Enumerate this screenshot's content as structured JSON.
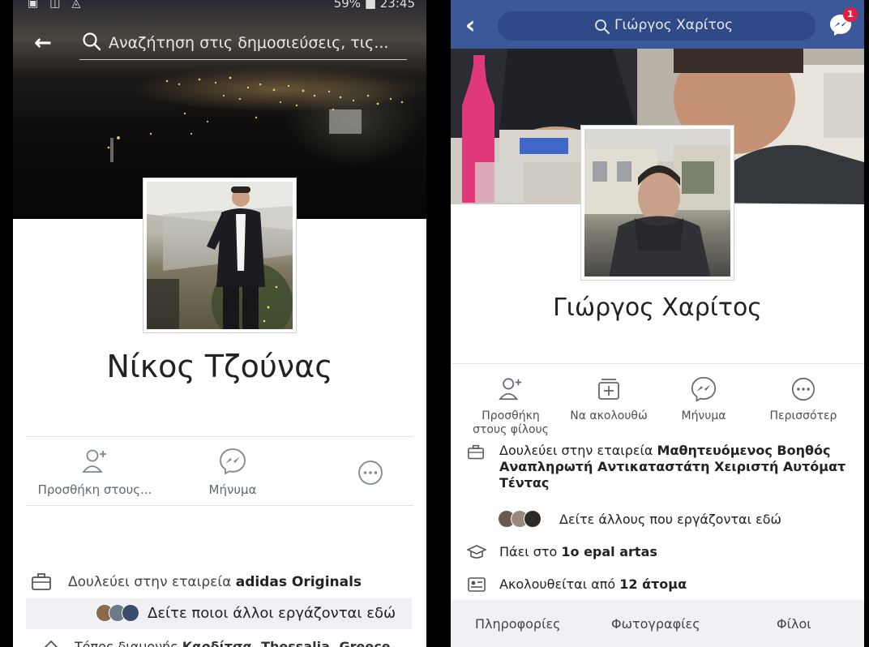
{
  "left": {
    "status_right": "59% ■ 23:45",
    "search_placeholder": "Αναζήτηση στις δημοσιεύσεις, τις...",
    "name": "Νίκος Τζούνας",
    "actions": [
      {
        "label": "Προσθήκη στους..."
      },
      {
        "label": "Μήνυμα"
      }
    ],
    "work_prefix": "Δουλεύει στην εταιρεία ",
    "work_company": "adidas Originals",
    "see_others": "Δείτε ποιοι άλλοι εργάζονται εδώ",
    "cutoff_prefix": "Τόπος διαμονής ",
    "cutoff_bold": "Καρδίτσα, Thessalia, Greece"
  },
  "right": {
    "search_text": "Γιώργος Χαρίτος",
    "messenger_badge": "1",
    "name": "Γιώργος Χαρίτος",
    "actions": [
      {
        "label_line1": "Προσθήκη",
        "label_line2": "στους φίλους"
      },
      {
        "label_line1": "Να ακολουθώ",
        "label_line2": ""
      },
      {
        "label_line1": "Μήνυμα",
        "label_line2": ""
      },
      {
        "label_line1": "Περισσότερ",
        "label_line2": ""
      }
    ],
    "work_prefix": "Δουλεύει στην εταιρεία ",
    "work_line1_bold": "Μαθητευόμενος Βοηθός",
    "work_line2_bold": "Αναπληρωτή Αντικαταστάτη Χειριστή Αυτόματ",
    "work_line3_bold": "Τέντας",
    "see_others": "Δείτε άλλους που εργάζονται εδώ",
    "school_prefix": "Πάει στο ",
    "school_bold": "1ο epal artas",
    "followers_prefix": "Ακολουθείται από ",
    "followers_bold": "12 άτομα",
    "tabs": [
      "Πληροφορίες",
      "Φωτογραφίες",
      "Φίλοι"
    ]
  },
  "colors": {
    "facebook_blue": "#3b5998",
    "badge_red": "#e41e3f",
    "pink_bottle": "#e0397a"
  }
}
